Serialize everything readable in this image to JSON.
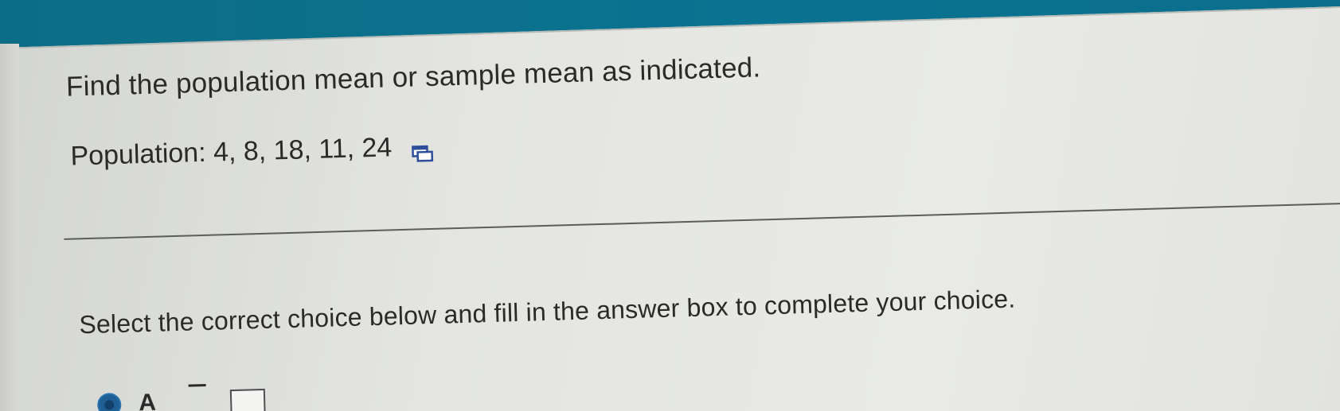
{
  "question": {
    "prompt": "Find the population mean or sample mean as indicated.",
    "data_label": "Population: 4, 8, 18, 11, 24",
    "data_icon": "copy-data-icon"
  },
  "instruction": "Select the correct choice below and fill in the answer box to complete your choice.",
  "choices": [
    {
      "letter": "A",
      "selected": true,
      "answer_value": ""
    }
  ],
  "colors": {
    "header": "#0a7391",
    "text": "#2a2a2a",
    "radio_selected": "#1f5f95"
  }
}
